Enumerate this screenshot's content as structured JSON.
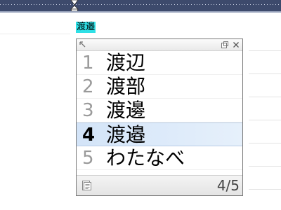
{
  "composition": {
    "text": "渡邉"
  },
  "candidate_window": {
    "candidates": [
      {
        "number": "1",
        "text": "渡辺"
      },
      {
        "number": "2",
        "text": "渡部"
      },
      {
        "number": "3",
        "text": "渡邊"
      },
      {
        "number": "4",
        "text": "渡邉",
        "selected": true
      },
      {
        "number": "5",
        "text": "わたなべ"
      }
    ],
    "page_indicator": "4/5"
  },
  "colors": {
    "ruler": "#3d4a6c",
    "highlight": "#2fe0e6",
    "selection": "#d3e4f8"
  },
  "icons": {
    "titlebar": [
      "resize-grip-icon",
      "float-window-icon",
      "close-icon"
    ],
    "footer": "candidate-list-icon",
    "ruler": "indent-marker-icon"
  }
}
